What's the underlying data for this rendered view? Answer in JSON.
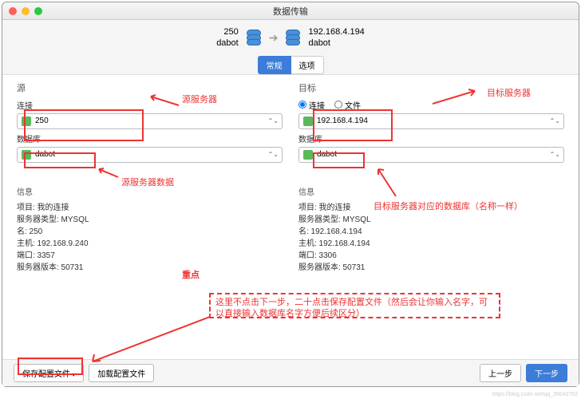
{
  "window": {
    "title": "数据传输"
  },
  "header": {
    "source_ip": "250",
    "source_db": "dabot",
    "target_ip": "192.168.4.194",
    "target_db": "dabot"
  },
  "tabs": {
    "general": "常规",
    "options": "选项"
  },
  "source": {
    "title": "源",
    "conn_label": "连接",
    "conn_value": "250",
    "db_label": "数据库",
    "db_value": "dabot"
  },
  "target": {
    "title": "目标",
    "radio_conn": "连接",
    "radio_file": "文件",
    "conn_value": "192.168.4.194",
    "db_label": "数据库",
    "db_value": "dabot"
  },
  "source_info": {
    "title": "信息",
    "lines": [
      "项目: 我的连接",
      "服务器类型: MYSQL",
      "名: 250",
      "主机: 192.168.9.240",
      "端口: 3357",
      "服务器版本: 50731"
    ]
  },
  "target_info": {
    "title": "信息",
    "lines": [
      "项目: 我的连接",
      "服务器类型: MYSQL",
      "名: 192.168.4.194",
      "主机: 192.168.4.194",
      "端口: 3306",
      "服务器版本: 50731"
    ]
  },
  "footer": {
    "save_profile": "保存配置文件",
    "load_profile": "加载配置文件",
    "prev": "上一步",
    "next": "下一步"
  },
  "annotations": {
    "src_server": "源服务器",
    "tgt_server": "目标服务器",
    "src_data": "源服务器数据",
    "tgt_db": "目标服务器对应的数据库（名称一样）",
    "key": "重点",
    "note": "这里不点击下一步，二十点击保存配置文件（然后会让你输入名字，可以直接输入数据库名字方便后续区分）"
  },
  "watermark": "https://blog.csdn.net/qq_39043762"
}
